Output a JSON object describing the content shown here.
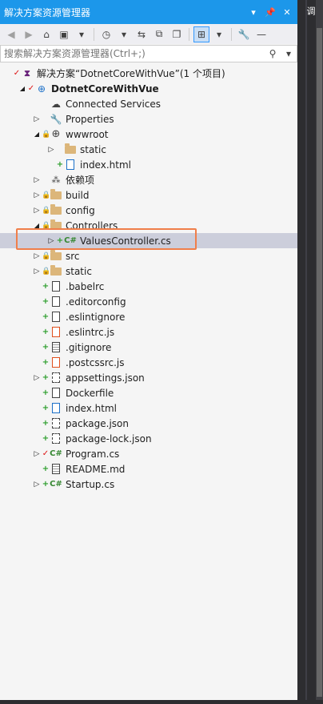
{
  "window": {
    "title": "解决方案资源管理器",
    "title_buttons": [
      "▾",
      "ᵃ",
      "✕"
    ]
  },
  "right_tab": {
    "label": "调"
  },
  "search": {
    "placeholder": "搜索解决方案资源管理器(Ctrl+;)"
  },
  "tree": [
    {
      "label": "解决方案“DotnetCoreWithVue”(1 个项目)",
      "indent": 0,
      "status": "chk",
      "icon": "solution",
      "expander": ""
    },
    {
      "label": "DotnetCoreWithVue",
      "indent": 1,
      "status": "chk",
      "icon": "project",
      "expander": "open",
      "bold": true
    },
    {
      "label": "Connected Services",
      "indent": 2,
      "status": "",
      "icon": "cloud",
      "expander": ""
    },
    {
      "label": "Properties",
      "indent": 2,
      "status": "",
      "icon": "wrench",
      "expander": "closed"
    },
    {
      "label": "wwwroot",
      "indent": 2,
      "status": "lock",
      "icon": "globe",
      "expander": "open"
    },
    {
      "label": "static",
      "indent": 3,
      "status": "",
      "icon": "folder",
      "expander": "closed"
    },
    {
      "label": "index.html",
      "indent": 3,
      "status": "add",
      "icon": "html",
      "expander": ""
    },
    {
      "label": "依赖项",
      "indent": 2,
      "status": "",
      "icon": "deps",
      "expander": "closed"
    },
    {
      "label": "build",
      "indent": 2,
      "status": "lock",
      "icon": "folder",
      "expander": "closed"
    },
    {
      "label": "config",
      "indent": 2,
      "status": "lock",
      "icon": "folder",
      "expander": "closed"
    },
    {
      "label": "Controllers",
      "indent": 2,
      "status": "lock",
      "icon": "folder",
      "expander": "open"
    },
    {
      "label": "ValuesController.cs",
      "indent": 3,
      "status": "add",
      "icon": "cs",
      "expander": "closed",
      "selected": true
    },
    {
      "label": "src",
      "indent": 2,
      "status": "lock",
      "icon": "folder",
      "expander": "closed"
    },
    {
      "label": "static",
      "indent": 2,
      "status": "lock",
      "icon": "folder",
      "expander": "closed"
    },
    {
      "label": ".babelrc",
      "indent": 2,
      "status": "add",
      "icon": "file",
      "expander": ""
    },
    {
      "label": ".editorconfig",
      "indent": 2,
      "status": "add",
      "icon": "file",
      "expander": ""
    },
    {
      "label": ".eslintignore",
      "indent": 2,
      "status": "add",
      "icon": "file",
      "expander": ""
    },
    {
      "label": ".eslintrc.js",
      "indent": 2,
      "status": "add",
      "icon": "js",
      "expander": ""
    },
    {
      "label": ".gitignore",
      "indent": 2,
      "status": "add",
      "icon": "textfile",
      "expander": ""
    },
    {
      "label": ".postcssrc.js",
      "indent": 2,
      "status": "add",
      "icon": "js",
      "expander": ""
    },
    {
      "label": "appsettings.json",
      "indent": 2,
      "status": "add",
      "icon": "json",
      "expander": "closed"
    },
    {
      "label": "Dockerfile",
      "indent": 2,
      "status": "add",
      "icon": "file",
      "expander": ""
    },
    {
      "label": "index.html",
      "indent": 2,
      "status": "add",
      "icon": "html",
      "expander": ""
    },
    {
      "label": "package.json",
      "indent": 2,
      "status": "add",
      "icon": "json",
      "expander": ""
    },
    {
      "label": "package-lock.json",
      "indent": 2,
      "status": "add",
      "icon": "json",
      "expander": ""
    },
    {
      "label": "Program.cs",
      "indent": 2,
      "status": "chk",
      "icon": "cs",
      "expander": "closed"
    },
    {
      "label": "README.md",
      "indent": 2,
      "status": "add",
      "icon": "textfile",
      "expander": ""
    },
    {
      "label": "Startup.cs",
      "indent": 2,
      "status": "add",
      "icon": "cs",
      "expander": "closed"
    }
  ]
}
